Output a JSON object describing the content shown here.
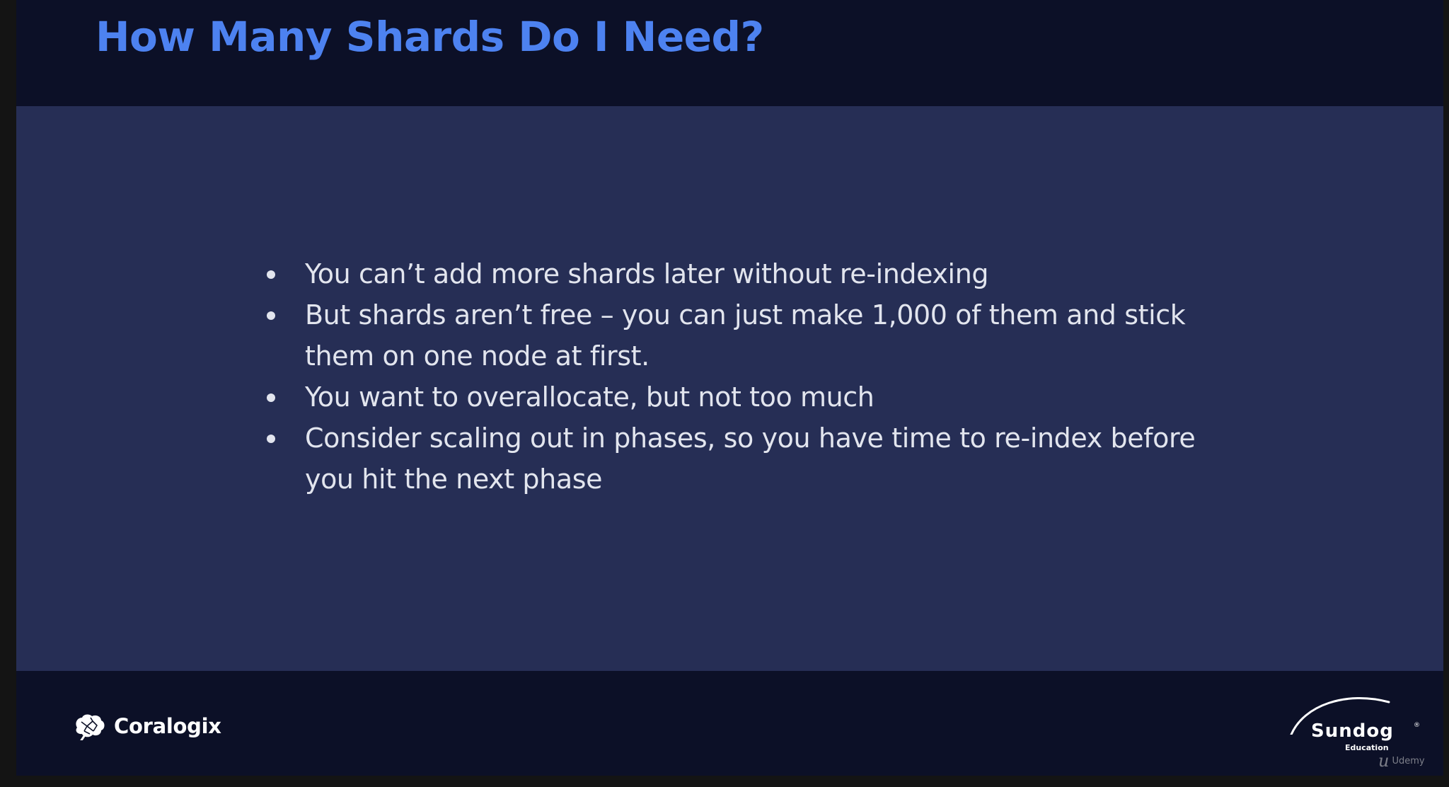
{
  "slide": {
    "title": "How Many Shards Do I Need?",
    "bullets": [
      "You can’t add more shards later without re-indexing",
      "But shards aren’t free – you can just make 1,000 of them and stick them on one node at first.",
      "You want to overallocate, but not too much",
      "Consider scaling out in phases, so you have time to re-index before you hit the next phase"
    ]
  },
  "footer": {
    "left_logo": {
      "icon": "brain-icon",
      "name": "Coralogix"
    },
    "right_logo": {
      "name": "Sundog",
      "trademark": "®",
      "subtitle": "Education"
    },
    "watermark": {
      "icon": "udemy-icon",
      "label": "Udemy"
    }
  },
  "colors": {
    "title": "#4d82f0",
    "header_bg": "#0c1027",
    "content_bg": "#262e55",
    "body_text": "#e2e5ee",
    "outer_bg": "#141414"
  }
}
